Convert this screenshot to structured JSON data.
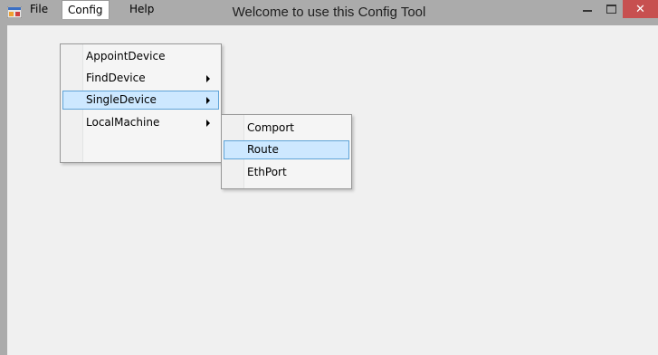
{
  "window": {
    "title": "Welcome  to use this Config Tool",
    "app_icon": "app-icon",
    "controls": {
      "minimize_icon": "minimize-icon",
      "maximize_icon": "maximize-icon",
      "close_label": "✕",
      "close_color": "#c75050"
    }
  },
  "menubar": {
    "items": [
      {
        "label": "File"
      },
      {
        "label": "Config"
      },
      {
        "label": "Help"
      }
    ]
  },
  "config_menu": {
    "items": [
      {
        "label": "AppointDevice"
      },
      {
        "label": "FindDevice",
        "submenu_icon": "chevron-right-icon"
      },
      {
        "label": "SingleDevice",
        "submenu_icon": "chevron-right-icon"
      },
      {
        "label": "LocalMachine",
        "submenu_icon": "chevron-right-icon"
      }
    ],
    "highlighted": "SingleDevice"
  },
  "singledevice_submenu": {
    "items": [
      {
        "label": "Comport"
      },
      {
        "label": "Route"
      },
      {
        "label": "EthPort"
      }
    ],
    "highlighted": "Route"
  },
  "colors": {
    "highlight_bg": "#cde8ff",
    "highlight_border": "#5fa4d8",
    "titlebar": "#ababab"
  }
}
